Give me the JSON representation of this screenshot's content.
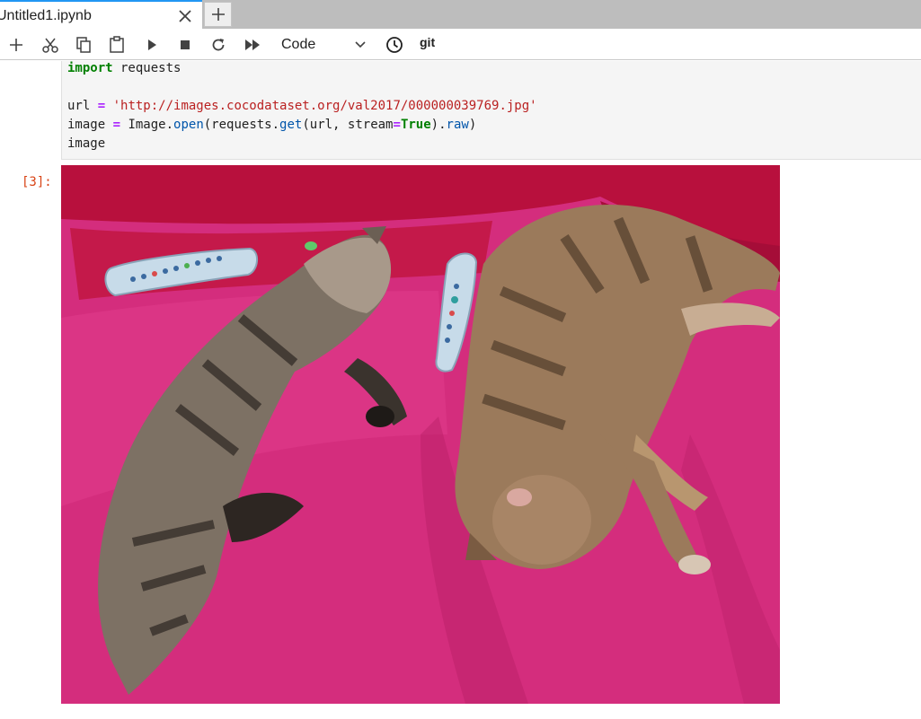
{
  "tab": {
    "title": "Untitled1.ipynb"
  },
  "toolbar": {
    "cell_type": "Code",
    "git_label": "git",
    "icons": [
      "add-icon",
      "cut-icon",
      "copy-icon",
      "paste-icon",
      "run-icon",
      "stop-icon",
      "restart-icon",
      "fast-forward-icon",
      "clock-icon"
    ]
  },
  "code_cell": {
    "line1": {
      "kw": "import",
      "rest": " requests"
    },
    "line3": {
      "a": "url ",
      "op": "=",
      "str": " 'http://images.cocodataset.org/val2017/000000039769.jpg'"
    },
    "line4": {
      "a": "image ",
      "op": "=",
      "b": " Image.",
      "fn1": "open",
      "c": "(requests.",
      "fn2": "get",
      "d": "(url, stream",
      "op2": "=",
      "kw": "True",
      "e": ").",
      "fn3": "raw",
      "f": ")"
    },
    "line5": "image"
  },
  "output": {
    "prompt": "[3]:",
    "image_desc": "two cats sleeping on a pink blanket with two remote controls"
  },
  "colors": {
    "accent": "#2196f3",
    "blanket": "#d42d7d",
    "prompt": "#d84315"
  }
}
